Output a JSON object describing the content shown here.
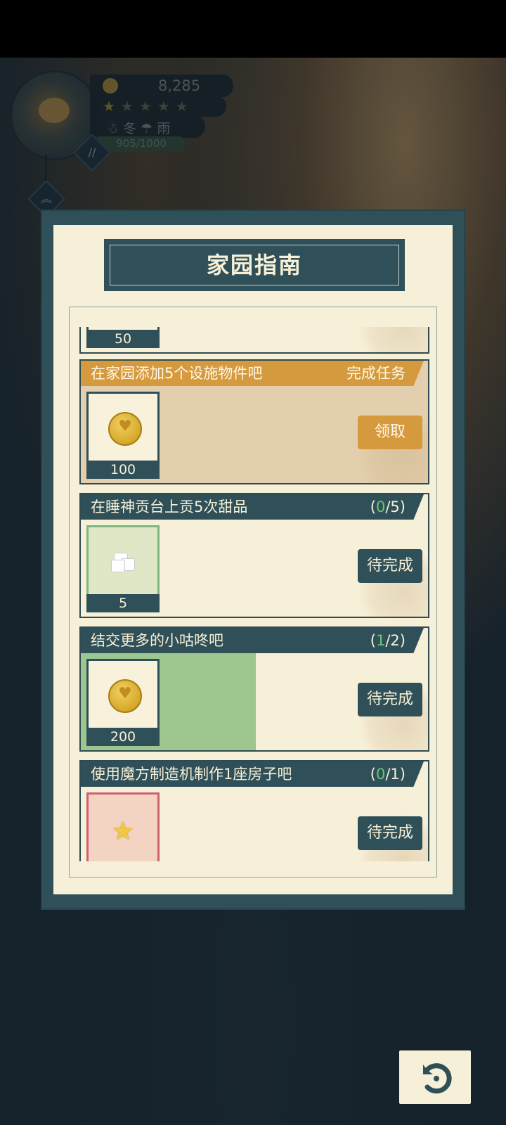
{
  "hud": {
    "coins": "8,285",
    "season": "冬",
    "weather": "雨",
    "exp": "905/1000",
    "stars_lit": 1,
    "stars_total": 5
  },
  "panel": {
    "title": "家园指南"
  },
  "tasks": [
    {
      "title": "",
      "reward_count": "50",
      "reward_icon": "coin-icon",
      "status": "partial"
    },
    {
      "title": "在家园添加5个设施物件吧",
      "status_text": "完成任务",
      "reward_count": "100",
      "reward_icon": "coin-icon",
      "button": "领取"
    },
    {
      "title": "在睡神贡台上贡5次甜品",
      "progress_current": "0",
      "progress_total": "/5)",
      "progress_open": "(",
      "reward_count": "5",
      "reward_icon": "sugar-cube-icon",
      "button": "待完成"
    },
    {
      "title": "结交更多的小咕咚吧",
      "progress_current": "1",
      "progress_total": "/2)",
      "progress_open": "(",
      "progress_fraction": 0.5,
      "reward_count": "200",
      "reward_icon": "coin-icon",
      "button": "待完成"
    },
    {
      "title": "使用魔方制造机制作1座房子吧",
      "progress_current": "0",
      "progress_total": "/1)",
      "progress_open": "(",
      "reward_icon": "star-icon",
      "button": "待完成"
    }
  ],
  "colors": {
    "panel_teal": "#2f5058",
    "paper": "#f7f0d8",
    "accent_orange": "#d69a3e",
    "progress_green": "#6cc47a"
  }
}
